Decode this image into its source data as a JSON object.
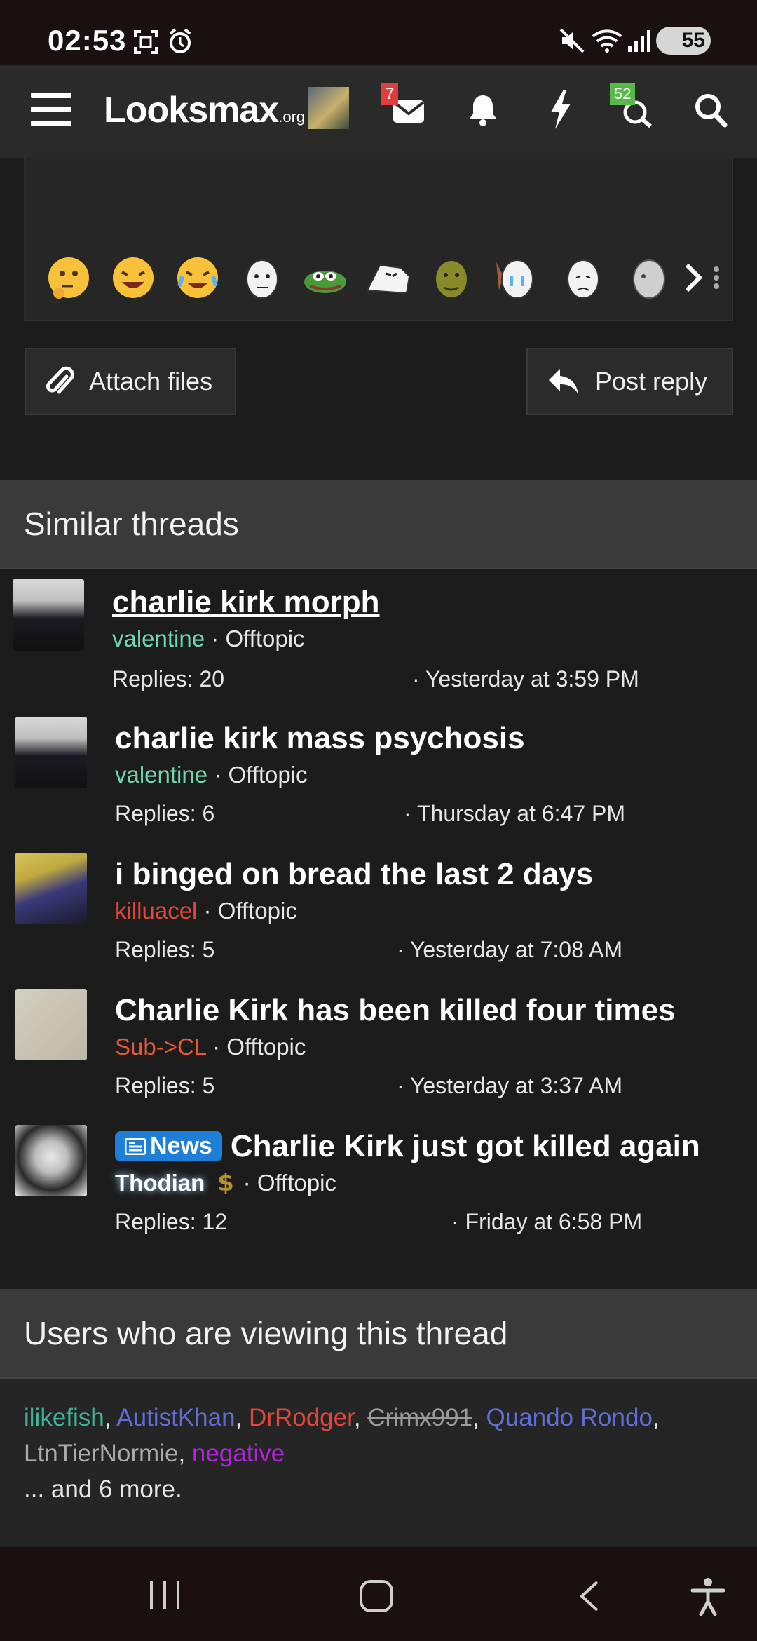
{
  "status_bar": {
    "time": "02:53",
    "battery": "55"
  },
  "navbar": {
    "logo_main": "Looksmax",
    "logo_suffix": ".org",
    "inbox_badge": "7",
    "alerts_badge": "52",
    "colors": {
      "inbox_badge": "#e23c3c",
      "alerts_badge": "#59b84a"
    }
  },
  "editor": {
    "emojis": [
      "thinking-face-icon",
      "laughing-face-icon",
      "crying-face-icon",
      "wojak-icon",
      "pepe-icon",
      "meme-face-icon",
      "shrek-icon",
      "crying-wojak-icon",
      "sad-wojak-icon",
      "grey-wojak-icon"
    ],
    "more_label": "more-emojis"
  },
  "actions": {
    "attach_label": "Attach files",
    "reply_label": "Post reply"
  },
  "similar": {
    "heading": "Similar threads",
    "threads": [
      {
        "title": "charlie kirk morph",
        "author": "valentine",
        "author_color": "#6fd6b0",
        "forum": "Offtopic",
        "replies": "Replies: 20",
        "date": "Yesterday at 3:59 PM"
      },
      {
        "title": "charlie kirk mass psychosis",
        "author": "valentine",
        "author_color": "#6fd6b0",
        "forum": "Offtopic",
        "replies": "Replies: 6",
        "date": "Thursday at 6:47 PM"
      },
      {
        "title": "i binged on bread the last 2 days",
        "author": "killuacel",
        "author_color": "#e0463c",
        "forum": "Offtopic",
        "replies": "Replies: 5",
        "date": "Yesterday at 7:08 AM"
      },
      {
        "title": "Charlie Kirk has been killed four times",
        "author": "Sub->CL",
        "author_color": "#e8572e",
        "forum": "Offtopic",
        "replies": "Replies: 5",
        "date": "Yesterday at 3:37 AM"
      },
      {
        "title": "Charlie Kirk just got killed again",
        "prefix": "News",
        "author": "Thodian",
        "author_color": "#ffffff",
        "forum": "Offtopic",
        "replies": "Replies: 12",
        "date": "Friday at 6:58 PM"
      }
    ]
  },
  "viewers": {
    "heading": "Users who are viewing this thread",
    "users": [
      {
        "name": "ilikefish",
        "color": "#3fb29a"
      },
      {
        "name": "AutistKhan",
        "color": "#5d6fd6"
      },
      {
        "name": "DrRodger",
        "color": "#e0463c"
      },
      {
        "name": "Crimx991",
        "color": "#9a9a9a"
      },
      {
        "name": "Quando Rondo",
        "color": "#5d6fd6"
      },
      {
        "name": "LtnTierNormie",
        "color": "#aaaaaa"
      },
      {
        "name": "negative",
        "color": "#b024d8"
      }
    ],
    "more": "... and 6 more."
  },
  "separator": " · ",
  "comma": ", "
}
